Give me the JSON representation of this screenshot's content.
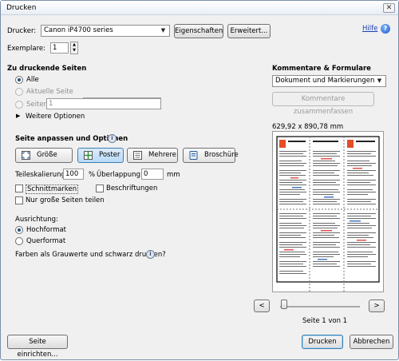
{
  "window": {
    "title": "Drucken",
    "close": "✕"
  },
  "printer": {
    "label": "Drucker:",
    "value": "Canon iP4700 series",
    "properties_button": "Eigenschaften",
    "advanced_button": "Erweitert...",
    "help_link": "Hilfe",
    "copies_label": "Exemplare:",
    "copies_value": "1"
  },
  "pages": {
    "heading": "Zu druckende Seiten",
    "all": "Alle",
    "current": "Aktuelle Seite",
    "pages_label": "Seiten",
    "pages_value": "1",
    "more_options": "Weitere Optionen"
  },
  "comments": {
    "heading": "Kommentare & Formulare",
    "value": "Dokument und Markierungen",
    "summarize_button": "Kommentare zusammenfassen"
  },
  "fit": {
    "heading": "Seite anpassen und Optionen",
    "buttons": [
      "Größe",
      "Poster",
      "Mehrere",
      "Broschüre"
    ],
    "active": "Poster",
    "tile_scale_label": "Teileskalierung:",
    "tile_scale_value": "100",
    "percent_sign": "%",
    "overlap_label": "Überlappung:",
    "overlap_value": "0",
    "overlap_unit": "mm",
    "cut_marks": "Schnittmarken",
    "labels": "Beschriftungen",
    "large_pages_only": "Nur große Seiten teilen"
  },
  "orientation": {
    "heading": "Ausrichtung:",
    "portrait": "Hochformat",
    "landscape": "Querformat",
    "grayscale": "Farben als Grauwerte und schwarz drucken?"
  },
  "preview": {
    "size": "629,92 x 890,78 mm",
    "page_indicator": "Seite 1 von 1",
    "prev": "<",
    "next": ">",
    "page_fill": 0.0
  },
  "footer": {
    "page_setup": "Seite einrichten...",
    "print": "Drucken",
    "cancel": "Abbrechen"
  }
}
